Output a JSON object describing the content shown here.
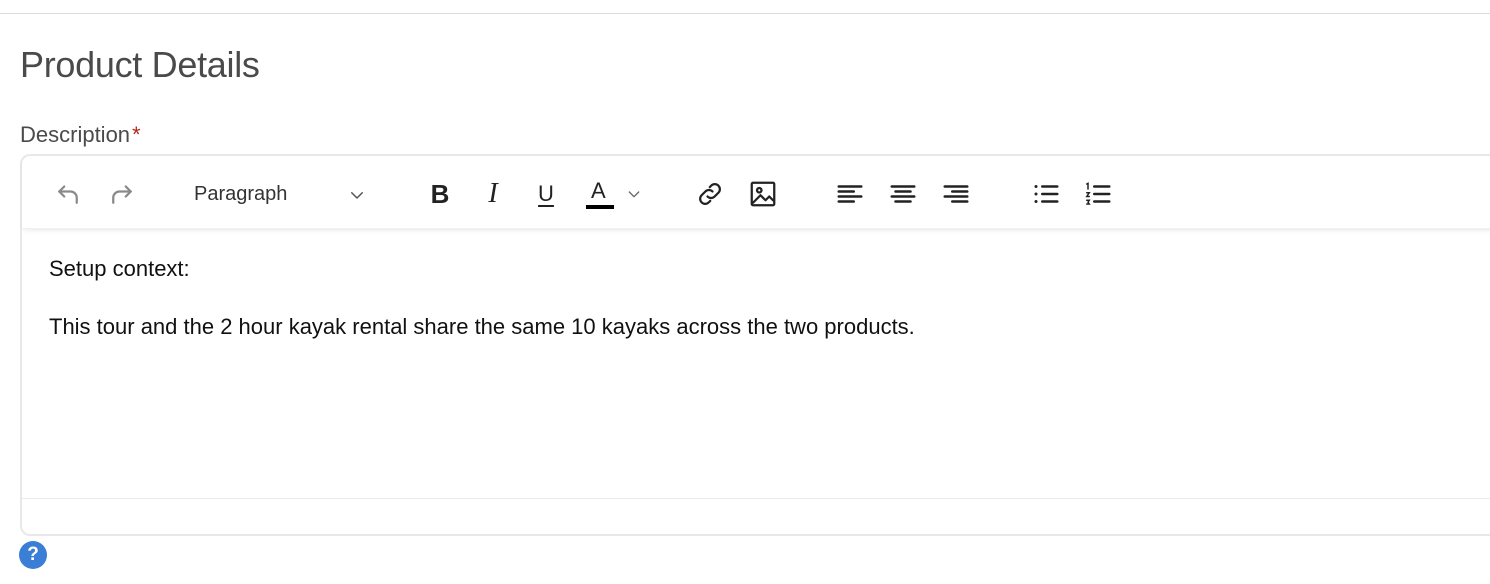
{
  "section": {
    "title": "Product Details"
  },
  "description_field": {
    "label": "Description",
    "required_marker": "*",
    "toolbar": {
      "undo_icon": "undo-icon",
      "redo_icon": "redo-icon",
      "block_format": "Paragraph",
      "bold_glyph": "B",
      "italic_glyph": "I",
      "underline_glyph": "U",
      "text_color_glyph": "A",
      "text_color_value": "#000000",
      "buttons": [
        "undo",
        "redo",
        "block-format",
        "bold",
        "italic",
        "underline",
        "text-color",
        "link",
        "image",
        "align-left",
        "align-center",
        "align-right",
        "bullet-list",
        "numbered-list"
      ]
    },
    "content": {
      "paragraphs": [
        "Setup context:",
        "This tour and the 2 hour kayak rental share the same 10 kayaks across the two products."
      ]
    }
  },
  "help": {
    "glyph": "?"
  },
  "colors": {
    "accent": "#3b7ed6",
    "required": "#b3261e",
    "icon": "#222222",
    "icon_muted": "#8a8a8a"
  }
}
